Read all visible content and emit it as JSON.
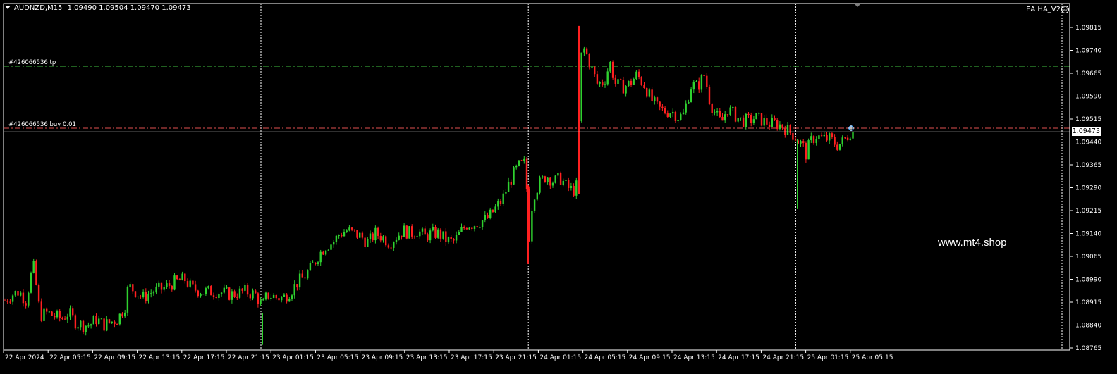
{
  "header": {
    "symbol_timeframe": "AUDNZD,M15",
    "ohlc": "1.09490 1.09504 1.09470 1.09473",
    "ea_label": "EA HA_V2"
  },
  "watermark": "www.mt4.shop",
  "current_price": "1.09473",
  "trade_lines": [
    {
      "label": "#426066536 tp",
      "price": 1.09688,
      "color": "#3fbf3f"
    },
    {
      "label": "#426066536 buy 0.01",
      "price": 1.09485,
      "color": "#e05050"
    }
  ],
  "price_axis": {
    "min": 1.08765,
    "max": 1.09815,
    "ticks": [
      "1.09815",
      "1.09740",
      "1.09665",
      "1.09590",
      "1.09515",
      "1.09440",
      "1.09365",
      "1.09290",
      "1.09215",
      "1.09140",
      "1.09065",
      "1.08990",
      "1.08915",
      "1.08840",
      "1.08765"
    ]
  },
  "time_axis": {
    "ticks": [
      "22 Apr 2024",
      "22 Apr 05:15",
      "22 Apr 09:15",
      "22 Apr 13:15",
      "22 Apr 17:15",
      "22 Apr 21:15",
      "23 Apr 01:15",
      "23 Apr 05:15",
      "23 Apr 09:15",
      "23 Apr 13:15",
      "23 Apr 17:15",
      "23 Apr 21:15",
      "24 Apr 01:15",
      "24 Apr 05:15",
      "24 Apr 09:15",
      "24 Apr 13:15",
      "24 Apr 17:15",
      "24 Apr 21:15",
      "25 Apr 01:15",
      "25 Apr 05:15"
    ]
  },
  "day_separators": [
    "22 Apr 21:15",
    "23 Apr 21:15",
    "24 Apr 21:15"
  ],
  "colors": {
    "bull": "#2fd12f",
    "bear": "#ff2020",
    "grid": "#ffffff",
    "background": "#000000"
  },
  "chart_data": {
    "type": "candlestick",
    "symbol": "AUDNZD",
    "timeframe": "M15",
    "close_path": [
      [
        0,
        1.0892
      ],
      [
        10,
        1.0894
      ],
      [
        20,
        1.0895
      ],
      [
        30,
        1.0892
      ],
      [
        40,
        1.0904
      ],
      [
        45,
        1.0896
      ],
      [
        50,
        1.0887
      ],
      [
        60,
        1.0888
      ],
      [
        70,
        1.0887
      ],
      [
        80,
        1.0886
      ],
      [
        90,
        1.0888
      ],
      [
        100,
        1.0885
      ],
      [
        110,
        1.0884
      ],
      [
        120,
        1.0884
      ],
      [
        130,
        1.0886
      ],
      [
        140,
        1.0884
      ],
      [
        150,
        1.0885
      ],
      [
        160,
        1.0886
      ],
      [
        170,
        1.089
      ],
      [
        175,
        1.0897
      ],
      [
        185,
        1.0895
      ],
      [
        195,
        1.0893
      ],
      [
        210,
        1.0895
      ],
      [
        225,
        1.0896
      ],
      [
        240,
        1.0898
      ],
      [
        255,
        1.0899
      ],
      [
        265,
        1.0896
      ],
      [
        280,
        1.0895
      ],
      [
        300,
        1.0895
      ],
      [
        320,
        1.0894
      ],
      [
        340,
        1.0895
      ],
      [
        355,
        1.0894
      ],
      [
        365,
        1.089
      ],
      [
        372,
        1.0894
      ],
      [
        385,
        1.0893
      ],
      [
        395,
        1.0893
      ],
      [
        405,
        1.0895
      ],
      [
        415,
        1.0898
      ],
      [
        425,
        1.09
      ],
      [
        435,
        1.0903
      ],
      [
        445,
        1.0907
      ],
      [
        455,
        1.091
      ],
      [
        465,
        1.0911
      ],
      [
        475,
        1.0914
      ],
      [
        485,
        1.0915
      ],
      [
        495,
        1.0914
      ],
      [
        505,
        1.0913
      ],
      [
        515,
        1.0911
      ],
      [
        525,
        1.0914
      ],
      [
        535,
        1.0913
      ],
      [
        545,
        1.0911
      ],
      [
        555,
        1.0913
      ],
      [
        565,
        1.0915
      ],
      [
        575,
        1.0914
      ],
      [
        585,
        1.0915
      ],
      [
        595,
        1.0913
      ],
      [
        605,
        1.0914
      ],
      [
        615,
        1.0914
      ],
      [
        625,
        1.0912
      ],
      [
        635,
        1.0911
      ],
      [
        645,
        1.0914
      ],
      [
        655,
        1.0917
      ],
      [
        665,
        1.0917
      ],
      [
        675,
        1.0918
      ],
      [
        685,
        1.0919
      ],
      [
        695,
        1.0922
      ],
      [
        705,
        1.0925
      ],
      [
        712,
        1.0929
      ],
      [
        720,
        1.0933
      ],
      [
        728,
        1.0936
      ],
      [
        738,
        1.0937
      ],
      [
        744,
        1.0912
      ],
      [
        748,
        1.0925
      ],
      [
        752,
        1.0928
      ],
      [
        760,
        1.0931
      ],
      [
        768,
        1.0933
      ],
      [
        778,
        1.0931
      ],
      [
        788,
        1.0932
      ],
      [
        798,
        1.0929
      ],
      [
        806,
        1.0928
      ],
      [
        812,
        1.093
      ],
      [
        816,
        1.097
      ],
      [
        820,
        1.0975
      ],
      [
        826,
        1.0972
      ],
      [
        832,
        1.0968
      ],
      [
        840,
        1.0963
      ],
      [
        850,
        1.0964
      ],
      [
        858,
        1.097
      ],
      [
        866,
        1.0963
      ],
      [
        876,
        1.0962
      ],
      [
        886,
        1.0963
      ],
      [
        896,
        1.0966
      ],
      [
        906,
        1.0963
      ],
      [
        916,
        1.0958
      ],
      [
        926,
        1.0955
      ],
      [
        936,
        1.0954
      ],
      [
        946,
        1.0954
      ],
      [
        956,
        1.0952
      ],
      [
        962,
        1.0953
      ],
      [
        968,
        1.0958
      ],
      [
        974,
        1.0963
      ],
      [
        982,
        1.0962
      ],
      [
        992,
        1.0966
      ],
      [
        1000,
        1.0957
      ],
      [
        1008,
        1.0953
      ],
      [
        1016,
        1.095
      ],
      [
        1024,
        1.0955
      ],
      [
        1034,
        1.0953
      ],
      [
        1044,
        1.0951
      ],
      [
        1054,
        1.0951
      ],
      [
        1064,
        1.0952
      ],
      [
        1074,
        1.0951
      ],
      [
        1084,
        1.095
      ],
      [
        1094,
        1.095
      ],
      [
        1104,
        1.0949
      ],
      [
        1114,
        1.0947
      ],
      [
        1120,
        1.0946
      ],
      [
        1126,
        1.0944
      ],
      [
        1131,
        1.0943
      ],
      [
        1136,
        1.094
      ],
      [
        1142,
        1.0944
      ],
      [
        1150,
        1.0946
      ],
      [
        1160,
        1.0945
      ],
      [
        1170,
        1.0945
      ],
      [
        1180,
        1.0943
      ],
      [
        1188,
        1.0944
      ],
      [
        1195,
        1.0946
      ],
      [
        1201,
        1.0948
      ],
      [
        1206,
        1.09473
      ]
    ]
  }
}
